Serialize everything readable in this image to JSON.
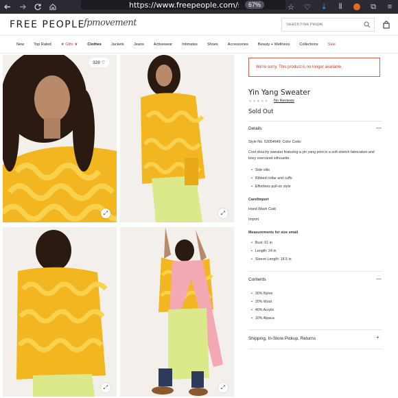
{
  "browser": {
    "url": "https://www.freepeople.com/shop",
    "zoom": "67%"
  },
  "header": {
    "logo": "FREE PEOPLE",
    "sub_brand": "fpmovement",
    "search_placeholder": "Search Free People"
  },
  "nav": {
    "items": [
      {
        "label": "New"
      },
      {
        "label": "Top Rated"
      },
      {
        "label": "★ Gifts ★"
      },
      {
        "label": "Clothes"
      },
      {
        "label": "Jackets"
      },
      {
        "label": "Jeans"
      },
      {
        "label": "Activewear"
      },
      {
        "label": "Intimates"
      },
      {
        "label": "Shoes"
      },
      {
        "label": "Accessories"
      },
      {
        "label": "Beauty + Wellness"
      },
      {
        "label": "Collections"
      },
      {
        "label": "Sale"
      }
    ]
  },
  "gallery": {
    "likes": "328"
  },
  "product": {
    "notice": "We're sorry. This product is no longer available.",
    "title": "Yin Yang Sweater",
    "stars": "★★★★★",
    "reviews": "No Reviews",
    "status": "Sold Out",
    "details_heading": "Details",
    "style_line": "Style No. 53054649; Color Code:",
    "description": "Cool slouchy sweater featuring a yin yang print in a soft-stretch fabrication and boxy oversized silhouette.",
    "features": [
      "Side slits",
      "Ribbed collar and cuffs",
      "Effortless pull-on style"
    ],
    "care_heading": "Care/Import",
    "care": "Hand Wash Cold",
    "import": "Import",
    "measurements_heading": "Measurements for size small",
    "measurements": [
      "Bust: 61 in",
      "Length: 24 in",
      "Sleeve Length: 18.5 in"
    ],
    "contents_heading": "Contents",
    "contents": [
      "30% Nylon",
      "20% Wool",
      "40% Acrylic",
      "10% Alpaca"
    ],
    "shipping_heading": "Shipping, In-Store Pickup, Returns",
    "minus": "—",
    "plus": "+"
  },
  "colors": {
    "sweater": "#f2b620",
    "pattern": "#f8d24c",
    "skirt": "#dbe98a",
    "scarf": "#f4a8b4",
    "bg": "#f3f0ec",
    "accent": "#c63a4e"
  }
}
